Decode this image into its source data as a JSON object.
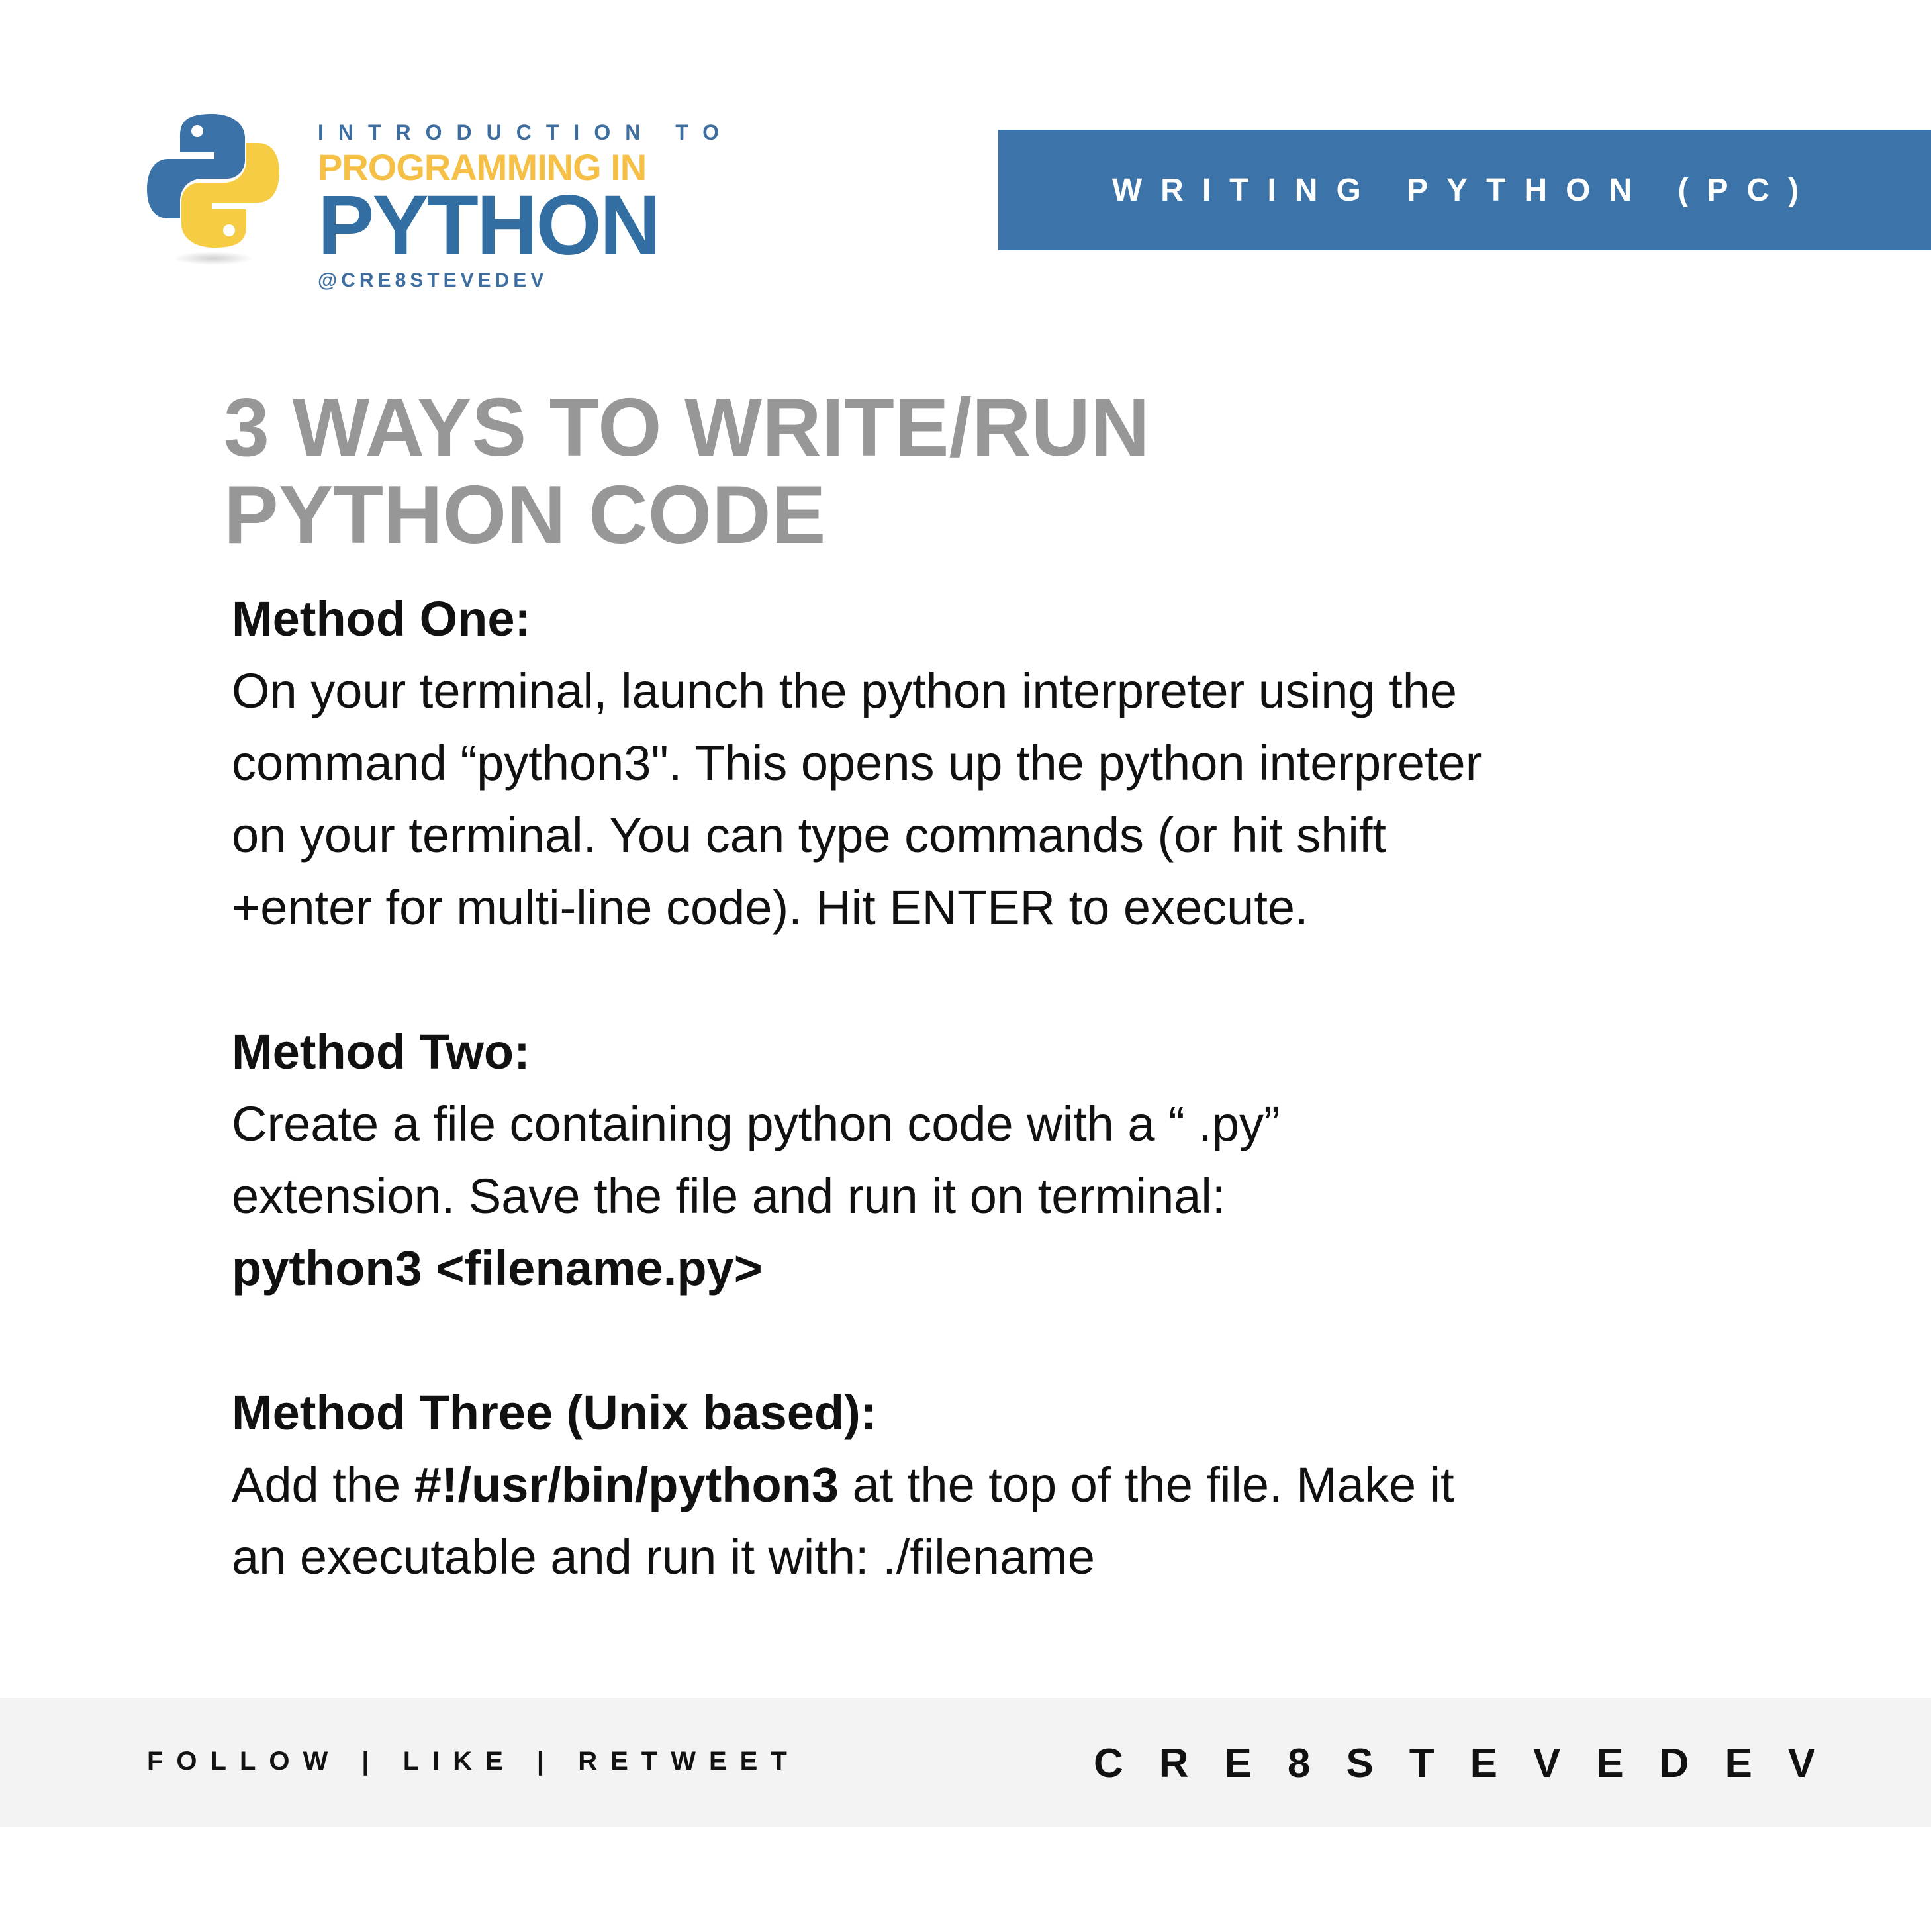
{
  "header": {
    "logo_icon": "python-logo-icon",
    "brand_kicker": "INTRODUCTION TO",
    "brand_line2": "PROGRAMMING IN",
    "brand_line3": "PYTHON",
    "brand_handle": "@CRE8STEVEDEV",
    "banner_text": "WRITING PYTHON (PC)"
  },
  "title": {
    "line1": "3 WAYS TO WRITE/RUN",
    "line2": "PYTHON CODE"
  },
  "method_one": {
    "heading": "Method One:",
    "lines": [
      "On your terminal, launch the python interpreter using the",
      "command “python3\". This opens up the python interpreter",
      "on your terminal. You can type commands (or hit shift",
      "+enter for multi-line code). Hit ENTER to execute."
    ]
  },
  "method_two": {
    "heading": "Method Two:",
    "lines": [
      "Create a file containing python code with a “ .py”",
      "extension. Save the file and run it on terminal:"
    ],
    "command": "python3 <filename.py>"
  },
  "method_three": {
    "heading": "Method Three (Unix based):",
    "line1_before": "Add the ",
    "line1_bold": "#!/usr/bin/python3",
    "line1_after": " at the top of the file. Make it",
    "line2": "an executable and run it with: ./filename"
  },
  "footer": {
    "left": "FOLLOW | LIKE | RETWEET",
    "right": "CRE8STEVEDEV"
  },
  "colors": {
    "brand_blue": "#3c74a9",
    "brand_yellow": "#f5c045",
    "title_gray": "#979797",
    "footer_bg": "#f3f3f3"
  }
}
